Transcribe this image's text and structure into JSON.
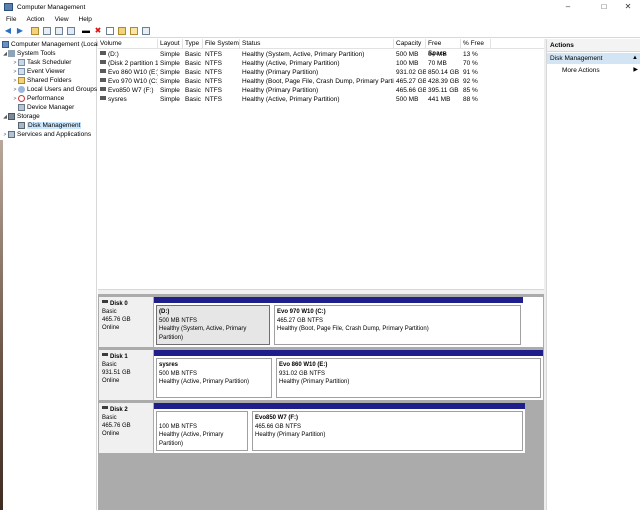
{
  "window": {
    "title": "Computer Management"
  },
  "menu": [
    "File",
    "Action",
    "View",
    "Help"
  ],
  "tree": {
    "root": "Computer Management (Local)",
    "system_tools": "System Tools",
    "task_scheduler": "Task Scheduler",
    "event_viewer": "Event Viewer",
    "shared_folders": "Shared Folders",
    "local_users": "Local Users and Groups",
    "performance": "Performance",
    "device_manager": "Device Manager",
    "storage": "Storage",
    "disk_management": "Disk Management",
    "services": "Services and Applications"
  },
  "volume_columns": [
    "Volume",
    "Layout",
    "Type",
    "File System",
    "Status",
    "Capacity",
    "Free Space",
    "% Free"
  ],
  "volumes": [
    [
      "(D:)",
      "Simple",
      "Basic",
      "NTFS",
      "Healthy (System, Active, Primary Partition)",
      "500 MB",
      "64 MB",
      "13 %"
    ],
    [
      "(Disk 2 partition 1)",
      "Simple",
      "Basic",
      "NTFS",
      "Healthy (Active, Primary Partition)",
      "100 MB",
      "70 MB",
      "70 %"
    ],
    [
      "Evo 860 W10 (E:)",
      "Simple",
      "Basic",
      "NTFS",
      "Healthy (Primary Partition)",
      "931.02 GB",
      "850.14 GB",
      "91 %"
    ],
    [
      "Evo 970 W10 (C:)",
      "Simple",
      "Basic",
      "NTFS",
      "Healthy (Boot, Page File, Crash Dump, Primary Partition)",
      "465.27 GB",
      "428.39 GB",
      "92 %"
    ],
    [
      "Evo850 W7 (F:)",
      "Simple",
      "Basic",
      "NTFS",
      "Healthy (Primary Partition)",
      "465.66 GB",
      "395.11 GB",
      "85 %"
    ],
    [
      "sysres",
      "Simple",
      "Basic",
      "NTFS",
      "Healthy (Active, Primary Partition)",
      "500 MB",
      "441 MB",
      "88 %"
    ]
  ],
  "disks": [
    {
      "name": "Disk 0",
      "type": "Basic",
      "size": "465.76 GB",
      "state": "Online",
      "partitions": [
        {
          "name": "(D:)",
          "size": "500 MB NTFS",
          "status": "Healthy (System, Active, Primary Partition)"
        },
        {
          "name": "Evo 970 W10  (C:)",
          "size": "465.27 GB NTFS",
          "status": "Healthy (Boot, Page File, Crash Dump, Primary Partition)"
        }
      ]
    },
    {
      "name": "Disk 1",
      "type": "Basic",
      "size": "931.51 GB",
      "state": "Online",
      "partitions": [
        {
          "name": "sysres",
          "size": "500 MB NTFS",
          "status": "Healthy (Active, Primary Partition)"
        },
        {
          "name": "Evo 860 W10  (E:)",
          "size": "931.02 GB NTFS",
          "status": "Healthy (Primary Partition)"
        }
      ]
    },
    {
      "name": "Disk 2",
      "type": "Basic",
      "size": "465.76 GB",
      "state": "Online",
      "partitions": [
        {
          "name": "",
          "size": "100 MB NTFS",
          "status": "Healthy (Active, Primary Partition)"
        },
        {
          "name": "Evo850 W7  (F:)",
          "size": "465.66 GB NTFS",
          "status": "Healthy (Primary Partition)"
        }
      ]
    }
  ],
  "actions": {
    "header": "Actions",
    "section": "Disk Management",
    "item": "More Actions"
  },
  "colors": {
    "partition_bar": "#1f1f8c",
    "selection": "#cce8ff",
    "action_section": "#d3e5f5"
  }
}
